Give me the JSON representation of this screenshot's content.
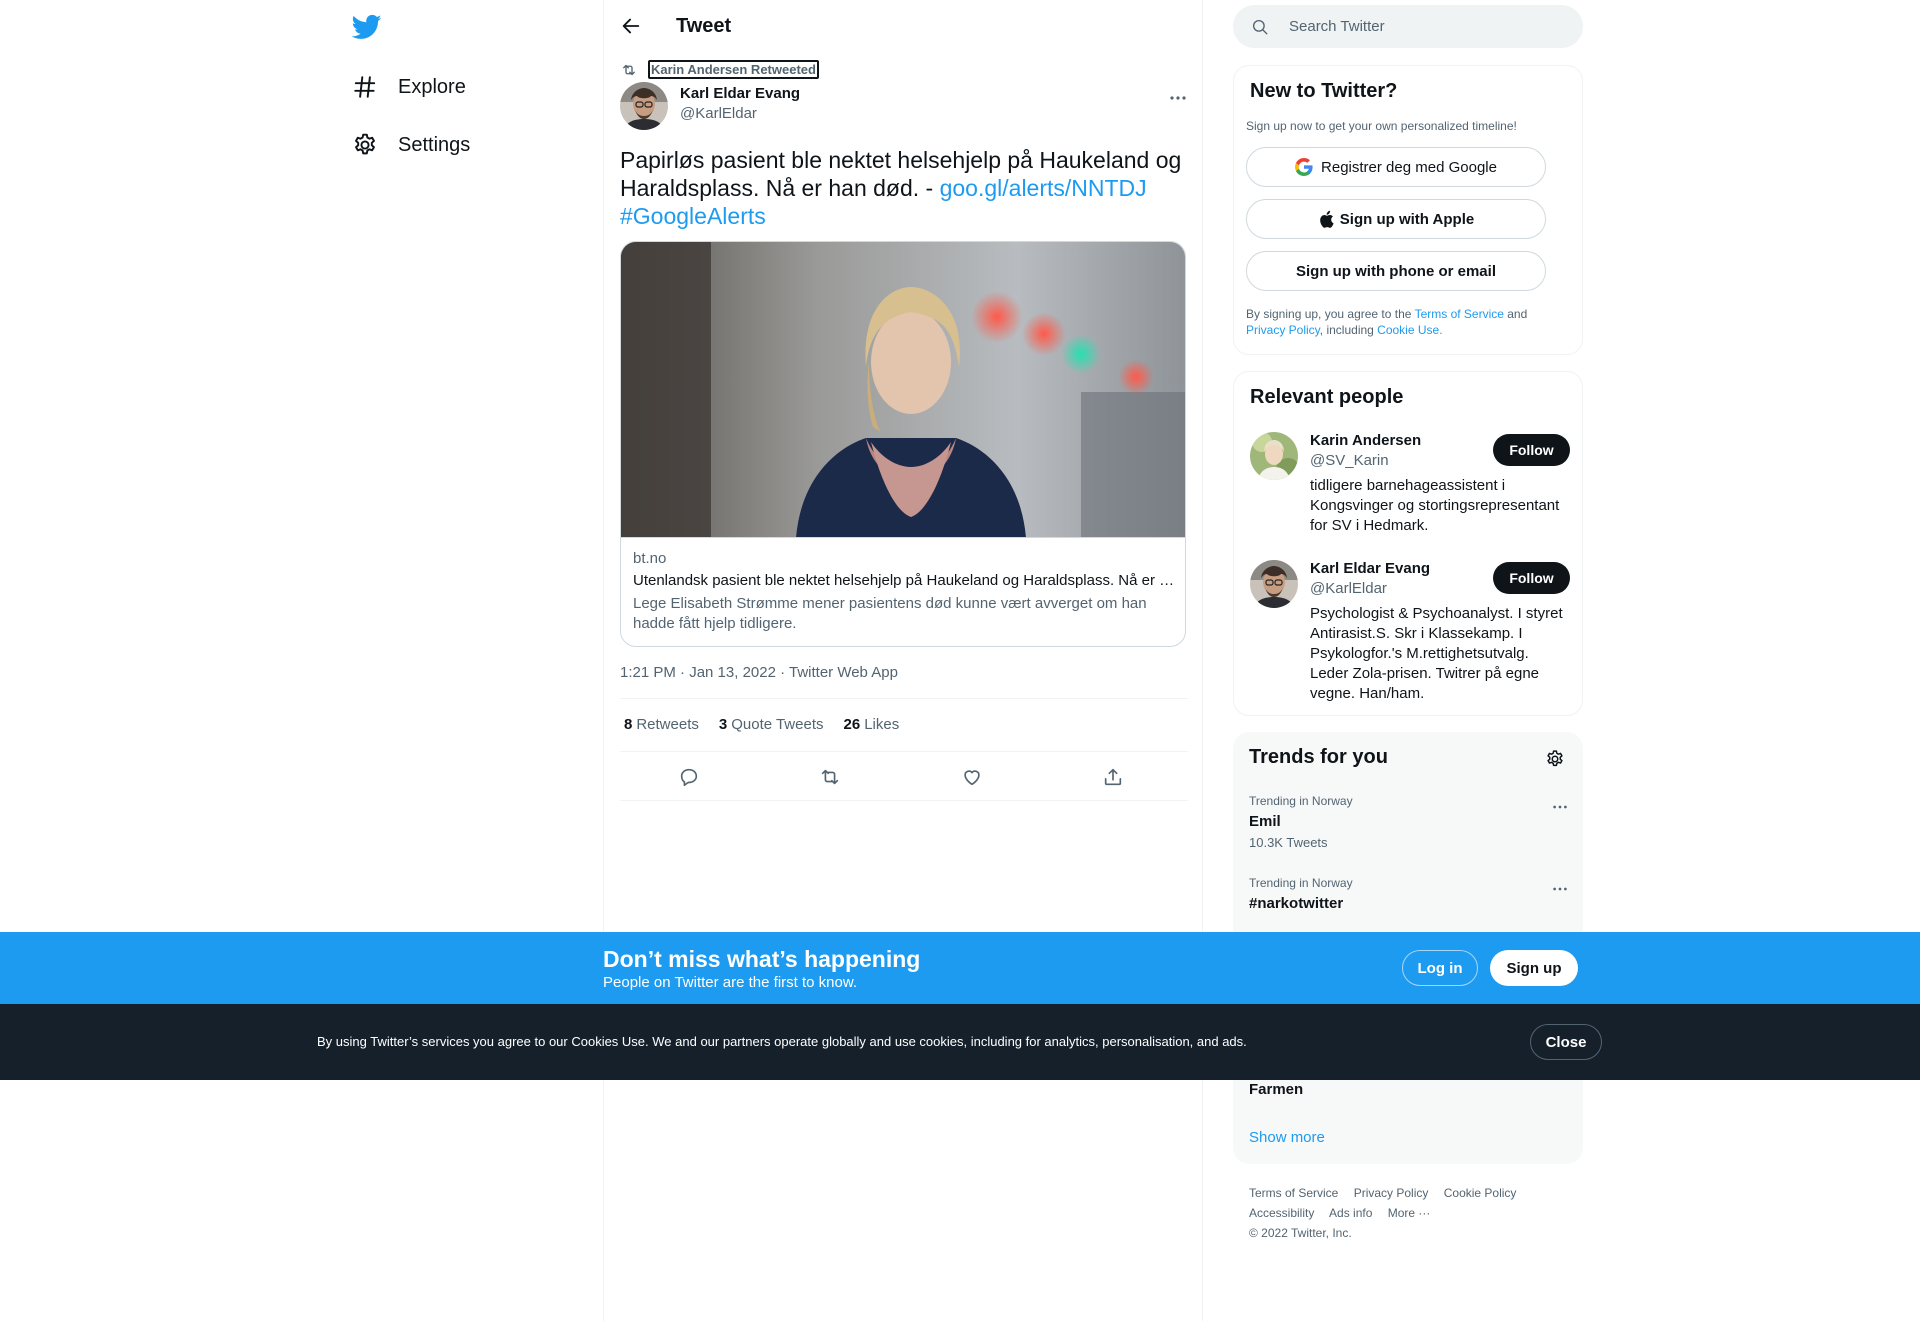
{
  "nav": {
    "logo_icon": "twitter-bird-icon",
    "items": [
      {
        "label": "Explore",
        "icon": "hashtag-icon"
      },
      {
        "label": "Settings",
        "icon": "gear-icon"
      }
    ]
  },
  "header": {
    "title": "Tweet",
    "back_icon": "arrow-left-icon"
  },
  "tweet": {
    "retweeted_by": "Karin Andersen Retweeted",
    "author_name": "Karl Eldar Evang",
    "author_handle": "@KarlEldar",
    "text_main": "Papirløs  pasient ble nektet helsehjelp på Haukeland og Haraldsplass. Nå er han død. - ",
    "link": "goo.gl/alerts/NNTDJ",
    "hashtag": "#GoogleAlerts",
    "card": {
      "domain": "bt.no",
      "title": "Utenlandsk pasient ble nektet helsehjelp på Haukeland og Haraldsplass. Nå er han død.",
      "description": "Lege Elisabeth Strømme mener pasientens død kunne vært avverget om han hadde fått hjelp tidligere."
    },
    "meta": "1:21 PM · Jan 13, 2022 · Twitter Web App",
    "stats": {
      "retweets_count": "8",
      "retweets_label": "Retweets",
      "quotes_count": "3",
      "quotes_label": "Quote Tweets",
      "likes_count": "26",
      "likes_label": "Likes"
    }
  },
  "search": {
    "placeholder": "Search Twitter"
  },
  "new_to_twitter": {
    "title": "New to Twitter?",
    "subtitle": "Sign up now to get your own personalized timeline!",
    "google_btn": "Registrer deg med Google",
    "apple_btn": "Sign up with Apple",
    "phone_btn": "Sign up with phone or email",
    "terms_1": "By signing up, you agree to the ",
    "terms_link_1": "Terms of Service",
    "terms_2": " and ",
    "terms_link_2": "Privacy Policy",
    "terms_3": ", including ",
    "terms_link_3": "Cookie Use."
  },
  "relevant_people": {
    "title": "Relevant people",
    "follow_label": "Follow",
    "people": [
      {
        "name": "Karin Andersen",
        "handle": "@SV_Karin",
        "bio": "tidligere barnehageassistent i Kongsvinger og stortingsrepresentant for SV i Hedmark."
      },
      {
        "name": "Karl Eldar Evang",
        "handle": "@KarlEldar",
        "bio": "Psychologist & Psychoanalyst. I styret Antirasist.S. Skr i Klassekamp. I Psykologfor.'s M.rettighetsutvalg. Leder Zola-prisen. Twitrer på egne vegne. Han/ham."
      }
    ]
  },
  "trends": {
    "title": "Trends for you",
    "items": [
      {
        "context": "Trending in Norway",
        "name": "Emil",
        "count": "10.3K Tweets"
      },
      {
        "context": "Trending in Norway",
        "name": "#narkotwitter",
        "count": ""
      }
    ],
    "partial_name": "Farmen",
    "show_more": "Show more"
  },
  "footer": {
    "links": [
      "Terms of Service",
      "Privacy Policy",
      "Cookie Policy",
      "Accessibility",
      "Ads info",
      "More ···"
    ],
    "copyright": "© 2022 Twitter, Inc."
  },
  "signup_bar": {
    "headline": "Don’t miss what’s happening",
    "sub": "People on Twitter are the first to know.",
    "login": "Log in",
    "signup": "Sign up"
  },
  "cookie_bar": {
    "text": "By using Twitter’s services you agree to our Cookies Use. We and our partners operate globally and use cookies, including for analytics, personalisation, and ads.",
    "close": "Close"
  },
  "colors": {
    "accent": "#1d9bf0",
    "text": "#0f1419",
    "muted": "#536471",
    "cookie_bg": "#15202b"
  }
}
